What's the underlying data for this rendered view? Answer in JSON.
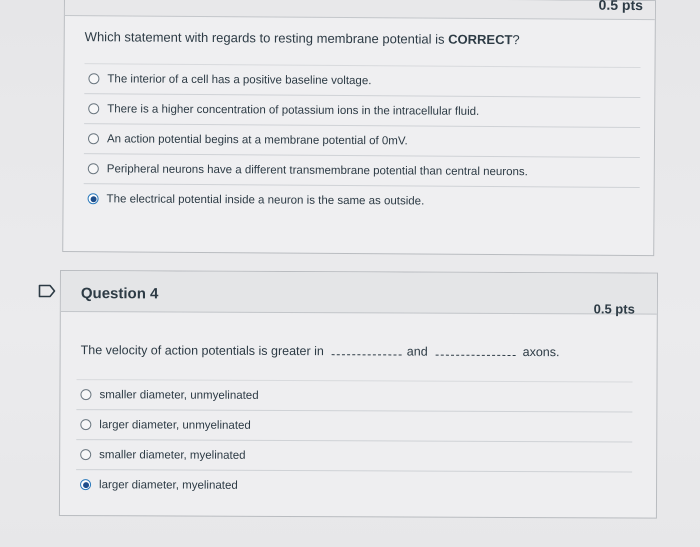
{
  "question3": {
    "points": "0.5 pts",
    "text_prefix": "Which statement with regards to resting membrane potential is ",
    "text_emphasis": "CORRECT",
    "text_suffix": "?",
    "answers": [
      {
        "label": "The interior of a cell has a positive baseline voltage.",
        "selected": false
      },
      {
        "label": "There is a higher concentration of potassium ions in the intracellular fluid.",
        "selected": false
      },
      {
        "label": "An action potential begins at a membrane potential of 0mV.",
        "selected": false
      },
      {
        "label": "Peripheral neurons have a different transmembrane potential than central neurons.",
        "selected": false
      },
      {
        "label": "The electrical potential inside a neuron is the same as outside.",
        "selected": true
      }
    ]
  },
  "question4": {
    "title": "Question 4",
    "points": "0.5 pts",
    "text_part1": "The velocity of action potentials is greater in",
    "text_part2": "and",
    "text_part3": "axons.",
    "answers": [
      {
        "label": "smaller diameter, unmyelinated",
        "selected": false
      },
      {
        "label": "larger diameter, unmyelinated",
        "selected": false
      },
      {
        "label": "smaller diameter, myelinated",
        "selected": false
      },
      {
        "label": "larger diameter, myelinated",
        "selected": true
      }
    ]
  },
  "colors": {
    "text": "#2d3b45",
    "radio_selected": "#1e4e8c",
    "border": "#b9bcc0"
  },
  "icons": {
    "flag": "flag-icon"
  }
}
